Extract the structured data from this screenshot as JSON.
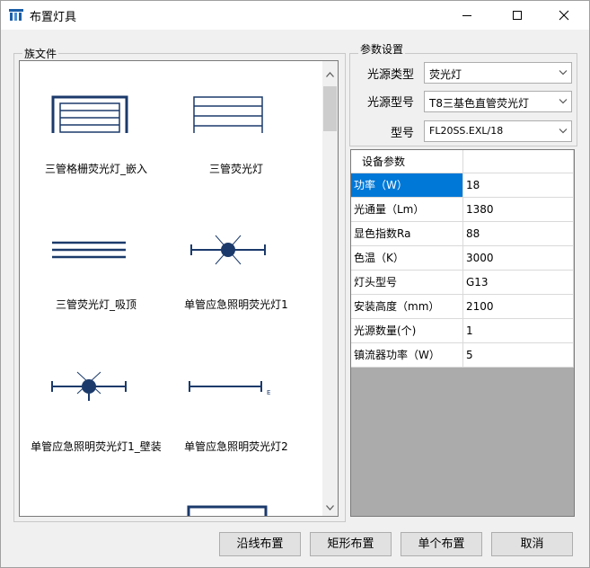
{
  "window": {
    "title": "布置灯具"
  },
  "family_group": {
    "legend": "族文件",
    "items": [
      {
        "label": "三管格栅荧光灯_嵌入",
        "icon": "grille-3-tube-icon"
      },
      {
        "label": "三管荧光灯",
        "icon": "three-tube-icon"
      },
      {
        "label": "三管荧光灯_吸顶",
        "icon": "three-line-icon"
      },
      {
        "label": "单管应急照明荧光灯1",
        "icon": "emergency-star-icon"
      },
      {
        "label": "单管应急照明荧光灯1_壁装",
        "icon": "emergency-wall-icon"
      },
      {
        "label": "单管应急照明荧光灯2",
        "icon": "emergency-e-icon"
      }
    ],
    "emergency_symbol": "E"
  },
  "params_group": {
    "legend": "参数设置",
    "light_source_type_label": "光源类型",
    "light_source_type_value": "荧光灯",
    "light_source_model_label": "光源型号",
    "light_source_model_value": "T8三基色直管荧光灯",
    "model_label": "型号",
    "model_value": "FL20SS.EXL/18"
  },
  "grid": {
    "header": "设备参数",
    "rows": [
      {
        "name": "功率（W）",
        "value": "18",
        "selected": true
      },
      {
        "name": "光通量（Lm）",
        "value": "1380"
      },
      {
        "name": "显色指数Ra",
        "value": "88"
      },
      {
        "name": "色温（K）",
        "value": "3000"
      },
      {
        "name": "灯头型号",
        "value": "G13"
      },
      {
        "name": "安装高度（mm）",
        "value": "2100"
      },
      {
        "name": "光源数量(个)",
        "value": "1"
      },
      {
        "name": "镇流器功率（W）",
        "value": "5"
      }
    ]
  },
  "buttons": {
    "along_line": "沿线布置",
    "rectangle": "矩形布置",
    "single": "单个布置",
    "cancel": "取消"
  },
  "colors": {
    "icon_blue": "#1b3a6b",
    "selection": "#0078d7"
  }
}
